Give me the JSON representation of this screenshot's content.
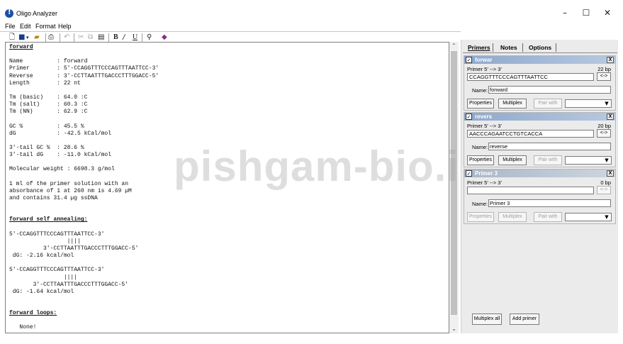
{
  "window": {
    "title": "Oligo Analyzer",
    "minimize": "–",
    "maximize": "☐",
    "close": "✕"
  },
  "menu": [
    "File",
    "Edit",
    "Format",
    "Help"
  ],
  "editor": {
    "lines": [
      {
        "t": "forward",
        "h": true
      },
      {
        "t": ""
      },
      {
        "t": "Name          : forward"
      },
      {
        "t": "Primer        : 5'-CCAGGTTTCCCAGTTTAATTCC-3'"
      },
      {
        "t": "Reverse       : 3'-CCTTAATTTGACCCTTTGGACC-5'"
      },
      {
        "t": "Length        : 22 nt"
      },
      {
        "t": ""
      },
      {
        "t": "Tm (basic)    : 64.0 :C"
      },
      {
        "t": "Tm (salt)     : 60.3 :C"
      },
      {
        "t": "Tm (NN)       : 62.9 :C"
      },
      {
        "t": ""
      },
      {
        "t": "GC %          : 45.5 %"
      },
      {
        "t": "dG            : -42.5 kCal/mol"
      },
      {
        "t": ""
      },
      {
        "t": "3'-tail GC %  : 28.6 %"
      },
      {
        "t": "3'-tail dG    : -11.0 kCal/mol"
      },
      {
        "t": ""
      },
      {
        "t": "Molecular weight : 6698.3 g/mol"
      },
      {
        "t": ""
      },
      {
        "t": "1 ml of the primer solution with an"
      },
      {
        "t": "absorbance of 1 at 260 nm is 4.69 µM"
      },
      {
        "t": "and contains 31.4 µg ssDNA"
      },
      {
        "t": ""
      },
      {
        "t": ""
      },
      {
        "t": "forward self annealing:",
        "h": true
      },
      {
        "t": ""
      },
      {
        "t": "5'-CCAGGTTTCCCAGTTTAATTCC-3'"
      },
      {
        "t": "                 ||||"
      },
      {
        "t": "          3'-CCTTAATTTGACCCTTTGGACC-5'"
      },
      {
        "t": " dG: -2.16 kcal/mol"
      },
      {
        "t": ""
      },
      {
        "t": "5'-CCAGGTTTCCCAGTTTAATTCC-3'"
      },
      {
        "t": "                ||||"
      },
      {
        "t": "       3'-CCTTAATTTGACCCTTTGGACC-5'"
      },
      {
        "t": " dG: -1.64 kcal/mol"
      },
      {
        "t": ""
      },
      {
        "t": ""
      },
      {
        "t": "forward loops:",
        "h": true
      },
      {
        "t": ""
      },
      {
        "t": "   None!"
      }
    ]
  },
  "watermark": "pishgam-bio.ir",
  "panel": {
    "tabs": [
      "Primers",
      "Notes",
      "Options"
    ],
    "primers": [
      {
        "title": "forwar",
        "checked": true,
        "active": true,
        "dir_label": "Primer  5' --> 3'",
        "length": "22 bp",
        "sequence": "CCAGGTTTCCCAGTTTAATTCC",
        "swap": "<->",
        "name_label": "Name:",
        "name": "forward",
        "properties": "Properties",
        "multiplex": "Multiplex",
        "pair_with": "Pair with"
      },
      {
        "title": "revers",
        "checked": true,
        "active": true,
        "dir_label": "Primer  5' --> 3'",
        "length": "20 bp",
        "sequence": "AACCCAGAATCCTGTCACCA",
        "swap": "<->",
        "name_label": "Name:",
        "name": "reverse",
        "properties": "Properties",
        "multiplex": "Multiplex",
        "pair_with": "Pair with"
      },
      {
        "title": "Primer 3",
        "checked": true,
        "active": false,
        "dir_label": "Primer  5' --> 3'",
        "length": "0 bp",
        "sequence": "",
        "swap": "<->",
        "name_label": "Name:",
        "name": "Primer 3",
        "properties": "Properties",
        "multiplex": "Multiplex",
        "pair_with": "Pair with"
      }
    ],
    "multiplex_all": "Multiplex all",
    "add_primer": "Add primer"
  },
  "colors": {
    "header_active": "#8ea8cc",
    "header_inactive": "#a9b6c8",
    "panel_bg": "#ebebeb"
  }
}
